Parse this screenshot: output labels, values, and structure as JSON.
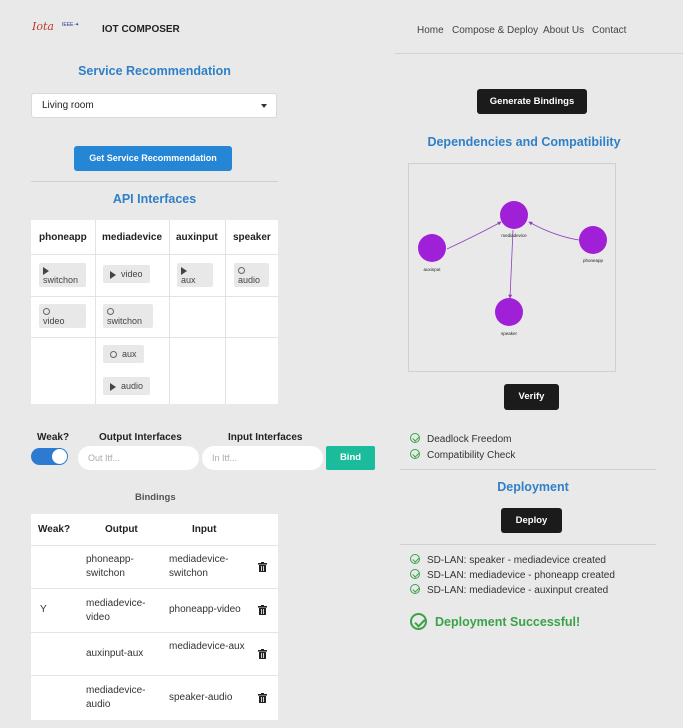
{
  "navbar": {
    "logo_text": "Iota",
    "logo_small": "IEEE·✦",
    "brand": "IOT COMPOSER",
    "links": [
      "Home",
      "Compose & Deploy",
      "About Us",
      "Contact"
    ]
  },
  "service": {
    "title": "Service Recommendation",
    "select_value": "Living room",
    "button": "Get Service Recommendation"
  },
  "api": {
    "title": "API Interfaces",
    "columns": [
      "phoneapp",
      "mediadevice",
      "auxinput",
      "speaker"
    ],
    "chips": {
      "phoneapp_switchon": "switchon",
      "phoneapp_video": "video",
      "mediadevice_video": "video",
      "mediadevice_switchon": "switchon",
      "mediadevice_aux": "aux",
      "mediadevice_audio": "audio",
      "auxinput_aux": "aux",
      "speaker_audio": "audio"
    }
  },
  "binding_form": {
    "weak_label": "Weak?",
    "output_label": "Output Interfaces",
    "input_label": "Input Interfaces",
    "output_placeholder": "Out Itf...",
    "input_placeholder": "In Itf...",
    "bind_button": "Bind",
    "weak_toggle_on": true
  },
  "bindings": {
    "title": "Bindings",
    "headers": [
      "Weak?",
      "Output",
      "Input"
    ],
    "rows": [
      {
        "weak": "",
        "output": "phoneapp-switchon",
        "input": "mediadevice-switchon"
      },
      {
        "weak": "Y",
        "output": "mediadevice-video",
        "input": "phoneapp-video"
      },
      {
        "weak": "",
        "output": "auxinput-aux",
        "input": "mediadevice-aux"
      },
      {
        "weak": "",
        "output": "mediadevice-audio",
        "input": "speaker-audio"
      }
    ]
  },
  "right": {
    "generate_button": "Generate Bindings",
    "deps_title": "Dependencies and Compatibility",
    "graph_nodes": {
      "mediadevice": "mediadevice",
      "auxinput": "auxinput",
      "phoneapp": "phoneapp",
      "speaker": "speaker"
    },
    "graph_node_color": "#a020d8",
    "verify_button": "Verify",
    "checks": [
      "Deadlock Freedom",
      "Compatibility Check"
    ],
    "deployment_title": "Deployment",
    "deploy_button": "Deploy",
    "deploy_log": [
      "SD-LAN: speaker - mediadevice created",
      "SD-LAN: mediadevice - phoneapp created",
      "SD-LAN: mediadevice - auxinput created"
    ],
    "success": "Deployment Successful!"
  }
}
